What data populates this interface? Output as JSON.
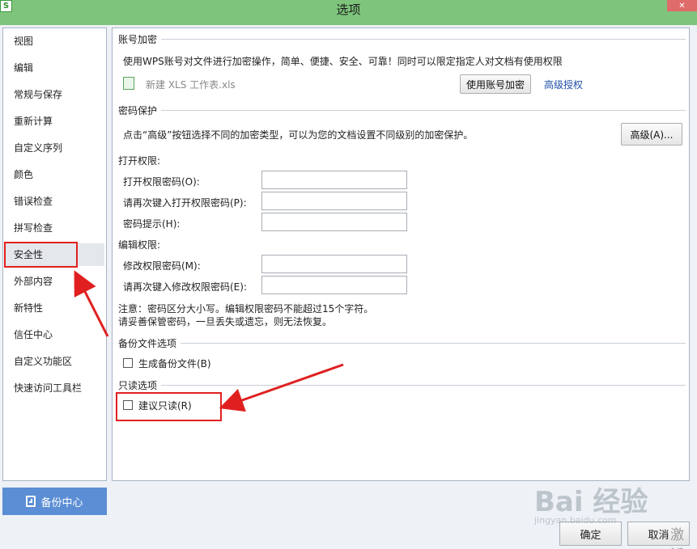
{
  "window": {
    "title": "选项",
    "app_icon_letter": "S",
    "close_glyph": "✕"
  },
  "sidebar": {
    "items": [
      {
        "label": "视图"
      },
      {
        "label": "编辑"
      },
      {
        "label": "常规与保存"
      },
      {
        "label": "重新计算"
      },
      {
        "label": "自定义序列"
      },
      {
        "label": "颜色"
      },
      {
        "label": "错误检查"
      },
      {
        "label": "拼写检查"
      },
      {
        "label": "安全性",
        "selected": true
      },
      {
        "label": "外部内容"
      },
      {
        "label": "新特性"
      },
      {
        "label": "信任中心"
      },
      {
        "label": "自定义功能区"
      },
      {
        "label": "快速访问工具栏"
      }
    ],
    "backup_button": "备份中心"
  },
  "account": {
    "heading": "账号加密",
    "description": "使用WPS账号对文件进行加密操作，简单、便捷、安全、可靠！同时可以限定指定人对文档有使用权限",
    "file_name": "新建 XLS 工作表.xls",
    "encrypt_button": "使用账号加密",
    "advanced_auth_link": "高级授权"
  },
  "password": {
    "heading": "密码保护",
    "description": "点击“高级”按钮选择不同的加密类型，可以为您的文档设置不同级别的加密保护。",
    "advanced_button": "高级(A)...",
    "open_heading": "打开权限:",
    "open_password_label": "打开权限密码(O):",
    "open_password_value": "",
    "open_confirm_label": "请再次键入打开权限密码(P):",
    "open_confirm_value": "",
    "hint_label": "密码提示(H):",
    "hint_value": "",
    "edit_heading": "编辑权限:",
    "edit_password_label": "修改权限密码(M):",
    "edit_password_value": "",
    "edit_confirm_label": "请再次键入修改权限密码(E):",
    "edit_confirm_value": "",
    "note_line1": "注意：密码区分大小写。编辑权限密码不能超过15个字符。",
    "note_line2": "请妥善保管密码，一旦丢失或遗忘，则无法恢复。"
  },
  "backup": {
    "heading": "备份文件选项",
    "checkbox_label": "生成备份文件(B)",
    "checked": false
  },
  "readonly": {
    "heading": "只读选项",
    "checkbox_label": "建议只读(R)",
    "checked": false
  },
  "footer": {
    "ok_button": "确定",
    "cancel_button": "取消"
  },
  "watermark": {
    "brand": "Bai  经验",
    "url": "jingyan.baidu.com",
    "activate": "激活"
  },
  "colors": {
    "titlebar": "#7ec47c",
    "annotation_red": "#e02020",
    "backup_button": "#5b8ed4"
  }
}
